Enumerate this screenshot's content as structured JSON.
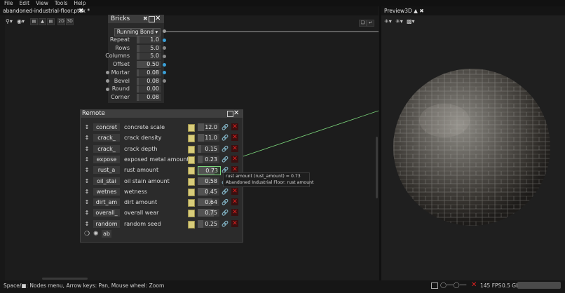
{
  "menu": [
    "File",
    "Edit",
    "View",
    "Tools",
    "Help"
  ],
  "tab": {
    "title": "abandoned-industrial-floor.ptex *",
    "close": "✖"
  },
  "toolbar": {
    "zoom_icon": "magnifier-icon",
    "view_icon": "eye-icon",
    "label_2d": "2D",
    "label_3d": "3D"
  },
  "bricks": {
    "title": "Bricks",
    "pattern": "Running Bond",
    "params": [
      {
        "label": "Repeat",
        "value": "1.0",
        "port": "#3aa0d8",
        "fill": 0.1
      },
      {
        "label": "Rows",
        "value": "5.0",
        "port": "#888888",
        "fill": 0.1
      },
      {
        "label": "Columns",
        "value": "5.0",
        "port": "#888888",
        "fill": 0.1
      },
      {
        "label": "Offset",
        "value": "0.50",
        "port": "#3aa0d8",
        "fill": 0.5
      },
      {
        "label": "Mortar",
        "value": "0.08",
        "port": "#3aa0d8",
        "fill": 0.08,
        "in": true
      },
      {
        "label": "Bevel",
        "value": "0.08",
        "port": "#888888",
        "fill": 0.08,
        "in": true
      },
      {
        "label": "Round",
        "value": "0.00",
        "port": "",
        "fill": 0.0,
        "in": true
      },
      {
        "label": "Corner",
        "value": "0.08",
        "port": "",
        "fill": 0.08
      }
    ]
  },
  "remote": {
    "title": "Remote",
    "rows": [
      {
        "id": "concret",
        "label": "concrete scale",
        "value": "12.0",
        "fill": 0.3
      },
      {
        "id": "crack_",
        "label": "crack density",
        "value": "11.0",
        "fill": 0.3
      },
      {
        "id": "crack_",
        "label": "crack depth",
        "value": "0.15",
        "fill": 0.15
      },
      {
        "id": "expose",
        "label": "exposed metal amount",
        "value": "0.23",
        "fill": 0.23
      },
      {
        "id": "rust_a",
        "label": "rust amount",
        "value": "0.73",
        "fill": 0.73,
        "active": true
      },
      {
        "id": "oil_stai",
        "label": "oil stain amount",
        "value": "0.58",
        "fill": 0.58
      },
      {
        "id": "wetnes",
        "label": "wetness",
        "value": "0.45",
        "fill": 0.45
      },
      {
        "id": "dirt_am",
        "label": "dirt amount",
        "value": "0.64",
        "fill": 0.64
      },
      {
        "id": "overall_",
        "label": "overall wear",
        "value": "0.75",
        "fill": 0.75
      },
      {
        "id": "random",
        "label": "random seed",
        "value": "0.25",
        "fill": 0.25
      }
    ],
    "footer_ab": "ab"
  },
  "tooltip": {
    "line1": "rust amount (rust_amount) = 0.73",
    "line2": "Abandoned Industrial Floor: rust amount"
  },
  "preview": {
    "title": "Preview3D"
  },
  "status": {
    "hint": "Space/■: Nodes menu, Arrow keys: Pan, Mouse wheel: Zoom",
    "fps": "145 FPS",
    "mem": "0.5 Gb"
  },
  "colors": {
    "accent_blue": "#3aa0d8",
    "link_green": "#7bd67b",
    "close_red": "#e02020"
  }
}
